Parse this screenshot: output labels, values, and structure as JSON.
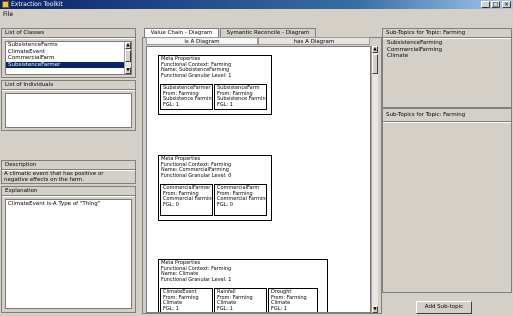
{
  "window": {
    "title": "Extraction Toolkit"
  },
  "menu": {
    "file": "File"
  },
  "classes": {
    "label": "List of Classes",
    "items": [
      "SubsistenceFarms",
      "ClimateEvent",
      "CommercialFarm",
      "SubsistenceFarmer"
    ],
    "selected_index": 3
  },
  "individuals": {
    "label": "List of Individuals"
  },
  "description": {
    "label": "Description",
    "text": [
      "A climatic event that has positive or",
      "negative effects on the farm."
    ]
  },
  "explanation": {
    "label": "Explanation",
    "text": "ClimateEvent is-A Type of \"Thing\""
  },
  "tabs": {
    "main": [
      "Value Chain - Diagram",
      "Symantic Reconcile - Diagram"
    ],
    "active_main": 0,
    "sub": [
      "is A Diagram",
      "has A Diagram"
    ],
    "active_sub": 0
  },
  "diagram": {
    "groups": [
      {
        "meta": [
          "Meta Properties",
          "Functional Context: Farming",
          "Name: SubsistenceFarming",
          "Functional Granular Level: 1"
        ],
        "children": [
          [
            "SubsistenceFarmer",
            "From: Farming",
            "Subsistence Farming",
            "FGL: 1"
          ],
          [
            "SubsistenceFarm",
            "From: Farming",
            "Subsistence Farming",
            "FGL: 1"
          ]
        ]
      },
      {
        "meta": [
          "Meta Properties",
          "Functional Context: Farming",
          "Name: CommercialFarming",
          "Functional Granular Level: 0"
        ],
        "children": [
          [
            "CommercialFarmer",
            "From: Farming",
            "Commercial Farming",
            "FGL: 0"
          ],
          [
            "CommercialFarm",
            "From: Farming",
            "Commercial Farming",
            "FGL: 0"
          ]
        ]
      },
      {
        "meta": [
          "Meta Properties",
          "Functional Context: Farming",
          "Name: Climate",
          "Functional Granular Level: 1"
        ],
        "children": [
          [
            "ClimateEvent",
            "From: Farming",
            "Climate",
            "FGL: 1"
          ],
          [
            "Rainfall",
            "From: Farming",
            "Climate",
            "FGL: 1"
          ],
          [
            "Drought",
            "From: Farming",
            "Climate",
            "FGL: 1"
          ]
        ]
      }
    ]
  },
  "subtopics_top": {
    "label": "Sub-Topics for Topic: Farming",
    "items": [
      "SubsistenceFarming",
      "CommercialFarming",
      "Climate"
    ]
  },
  "subtopics_bottom": {
    "label": "Sub-Topics for Topic: Farming"
  },
  "add_button": "Add Sub-topic"
}
